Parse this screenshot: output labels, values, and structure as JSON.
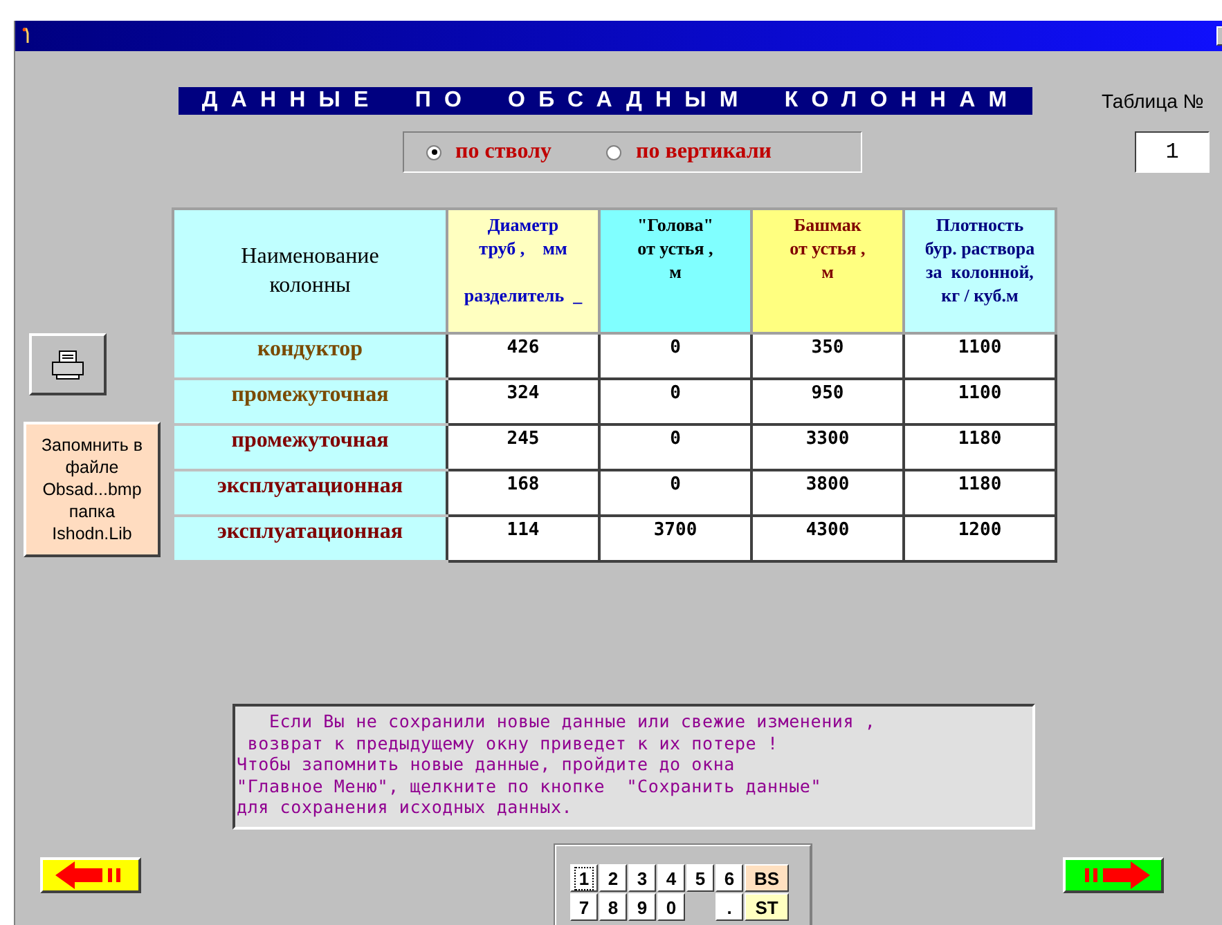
{
  "banner": "ДАННЫЕ ПО ОБСАДНЫМ КОЛОННАМ",
  "table_number": {
    "label": "Таблица №",
    "value": "1"
  },
  "mode": [
    {
      "label": "по стволу",
      "selected": true
    },
    {
      "label": "по вертикали",
      "selected": false
    }
  ],
  "save_button": {
    "lines": [
      "Запомнить в",
      "файле",
      "Obsad...bmp",
      "папка",
      "Ishodn.Lib"
    ]
  },
  "table": {
    "columns": [
      {
        "kind": "name",
        "lines": [
          "Наименование",
          "колонны"
        ]
      },
      {
        "kind": "diameter",
        "lines": [
          "Диаметр",
          "труб ,    мм",
          "разделитель  _"
        ]
      },
      {
        "kind": "top",
        "lines": [
          "\"Голова\"",
          "от устья ,",
          "м"
        ]
      },
      {
        "kind": "shoe",
        "lines": [
          "Башмак",
          "от устья ,",
          "м"
        ]
      },
      {
        "kind": "density",
        "lines": [
          "Плотность",
          "бур. раствора",
          "за  колонной,",
          "кг / куб.м"
        ]
      }
    ],
    "rows": [
      {
        "color": "#7a4a00",
        "cells": [
          "кондуктор",
          "426",
          "0",
          "350",
          "1100"
        ]
      },
      {
        "color": "#7a4a00",
        "cells": [
          "промежуточная",
          "324",
          "0",
          "950",
          "1100"
        ]
      },
      {
        "color": "#800000",
        "cells": [
          "промежуточная",
          "245",
          "0",
          "3300",
          "1180"
        ]
      },
      {
        "color": "#800000",
        "cells": [
          "эксплуатационная",
          "168",
          "0",
          "3800",
          "1180"
        ]
      },
      {
        "color": "#800000",
        "cells": [
          "эксплуатационная",
          "114",
          "3700",
          "4300",
          "1200"
        ]
      }
    ]
  },
  "warning": [
    "   Если Вы не сохранили новые данные или свежие изменения ,",
    " возврат к предыдущему окну приведет к их потере !",
    "Чтобы запомнить новые данные, пройдите до окна",
    "\"Главное Меню\", щелкните по кнопке  \"Сохранить данные\"",
    "для сохранения исходных данных."
  ],
  "keypad": [
    [
      {
        "label": "1",
        "focused": true
      },
      {
        "label": "2",
        "focused": false
      },
      {
        "label": "3",
        "focused": false
      },
      {
        "label": "4",
        "focused": false
      },
      {
        "label": "5",
        "focused": false
      },
      {
        "label": "6",
        "focused": false
      },
      {
        "label": "BS",
        "focused": false,
        "color": "#ffe0c0"
      }
    ],
    [
      {
        "label": "7",
        "focused": false
      },
      {
        "label": "8",
        "focused": false
      },
      {
        "label": "9",
        "focused": false
      },
      {
        "label": "0",
        "focused": false
      },
      {
        "kind": "gap"
      },
      {
        "label": ".",
        "focused": false
      },
      {
        "label": "ST",
        "focused": false,
        "color": "#ffffc0"
      }
    ]
  ],
  "nav": [
    {
      "kind": "back",
      "color": "#ffff00"
    },
    {
      "kind": "next",
      "color": "#00ff00"
    }
  ]
}
